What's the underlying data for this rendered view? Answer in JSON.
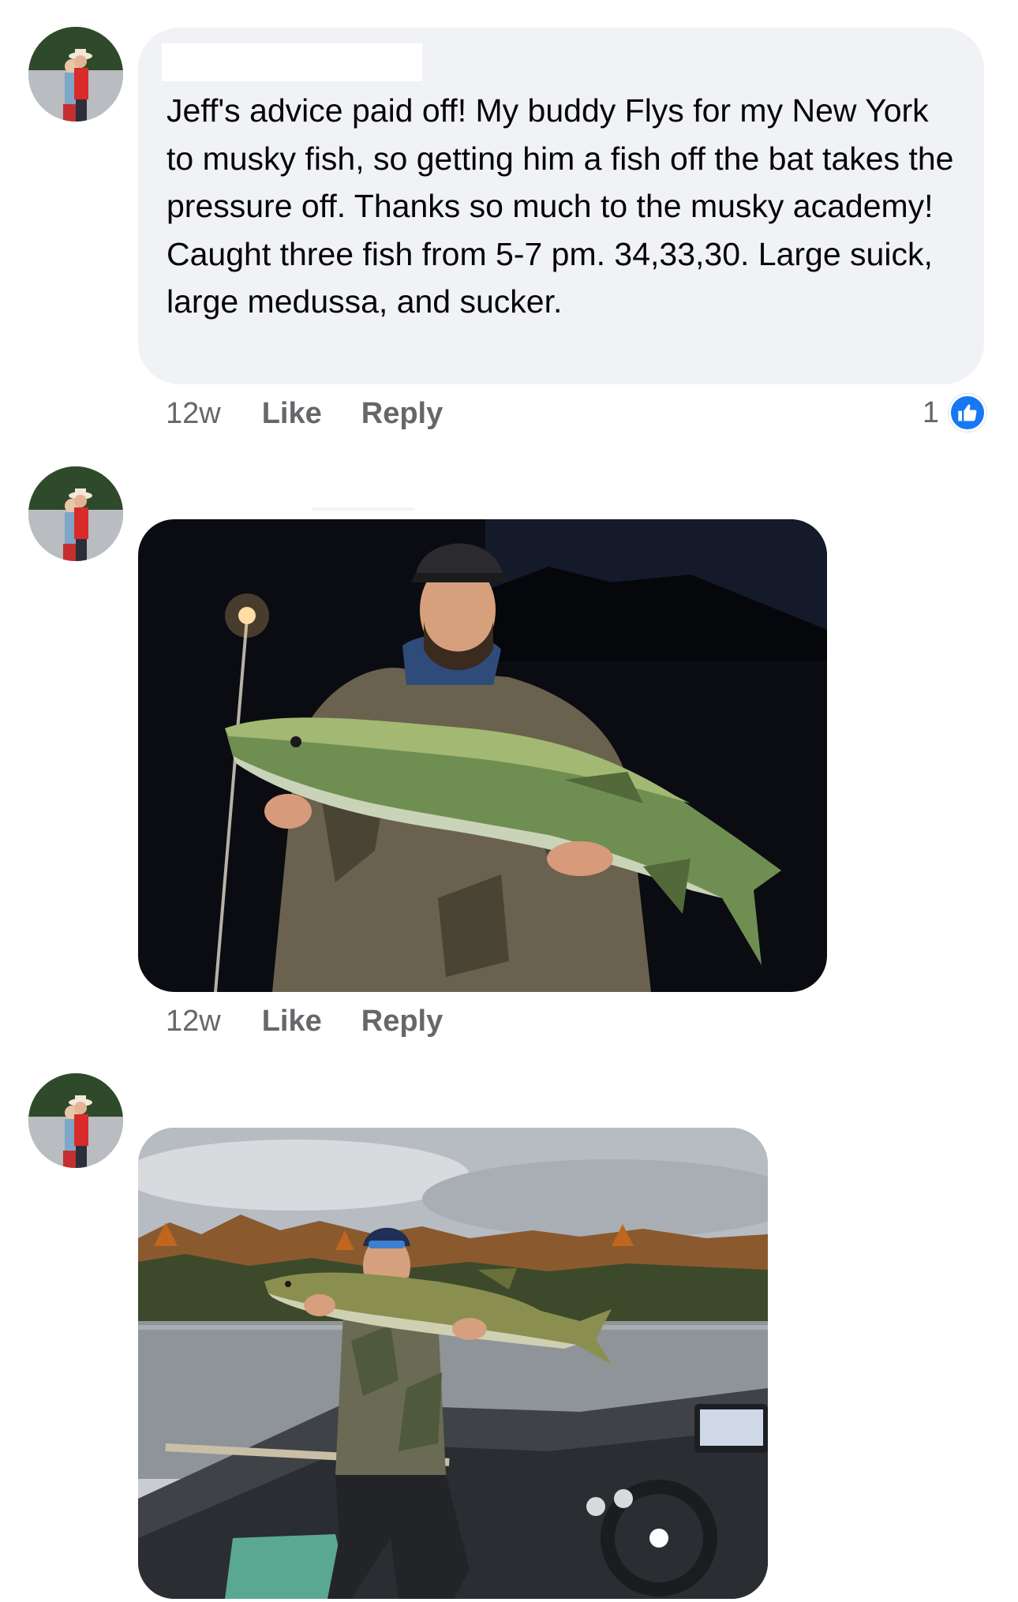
{
  "comments": [
    {
      "text": "Jeff's advice paid off! My buddy Flys for my New York to musky fish, so getting him a fish off the bat takes the pressure off. Thanks so much to the musky academy! Caught three fish from 5-7 pm. 34,33,30. Large suick, large medussa, and sucker.",
      "time": "12w",
      "like_label": "Like",
      "reply_label": "Reply",
      "reaction_count": "1",
      "reaction_icon": "thumbs-up-icon",
      "reaction_color": "#1877f2"
    },
    {
      "photo": "night-musky-photo",
      "time": "12w",
      "like_label": "Like",
      "reply_label": "Reply"
    },
    {
      "photo": "lake-musky-photo"
    }
  ],
  "colors": {
    "bubble": "#f0f2f5",
    "text": "#050505",
    "meta": "#65676b",
    "accent": "#1877f2"
  }
}
